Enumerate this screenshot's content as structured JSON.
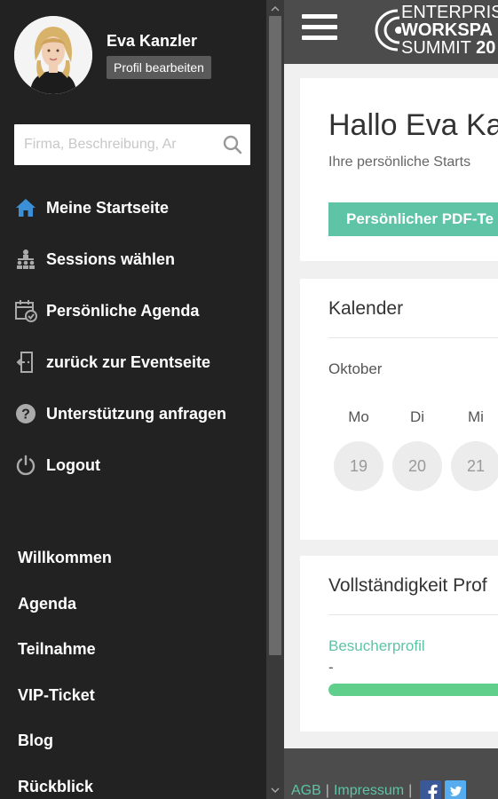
{
  "user": {
    "name": "Eva Kanzler",
    "edit_profile": "Profil bearbeiten"
  },
  "search": {
    "placeholder": "Firma, Beschreibung, Ar"
  },
  "menu": [
    {
      "label": "Meine Startseite",
      "icon": "home-icon"
    },
    {
      "label": "Sessions wählen",
      "icon": "sessions-icon"
    },
    {
      "label": "Persönliche Agenda",
      "icon": "calendar-icon"
    },
    {
      "label": "zurück zur Eventseite",
      "icon": "exit-icon"
    },
    {
      "label": "Unterstützung anfragen",
      "icon": "help-icon"
    },
    {
      "label": "Logout",
      "icon": "power-icon"
    }
  ],
  "nav2": [
    "Willkommen",
    "Agenda",
    "Teilnahme",
    "VIP-Ticket",
    "Blog",
    "Rückblick"
  ],
  "logo": {
    "line1": "ENTERPRISE",
    "line2": "WORKSPA",
    "line3": "SUMMIT",
    "year": "20"
  },
  "welcome": {
    "greeting": "Hallo Eva Ka",
    "subtitle": "Ihre persönliche Starts",
    "pdf_button": "Persönlicher PDF-Te"
  },
  "calendar": {
    "title": "Kalender",
    "month": "Oktober",
    "weekdays": [
      "Mo",
      "Di",
      "Mi"
    ],
    "days": [
      "19",
      "20",
      "21"
    ]
  },
  "completeness": {
    "title": "Vollständigkeit Prof",
    "visitor_label": "Besucherprofil",
    "visitor_value": "-",
    "progress": 1.0
  },
  "footer": {
    "agb": "AGB",
    "impressum": "Impressum",
    "separator": "|"
  },
  "colors": {
    "accent": "#5fc3a5",
    "progress": "#5fcf8b",
    "sidebar": "#222222",
    "topbar": "#4c4c4c"
  }
}
